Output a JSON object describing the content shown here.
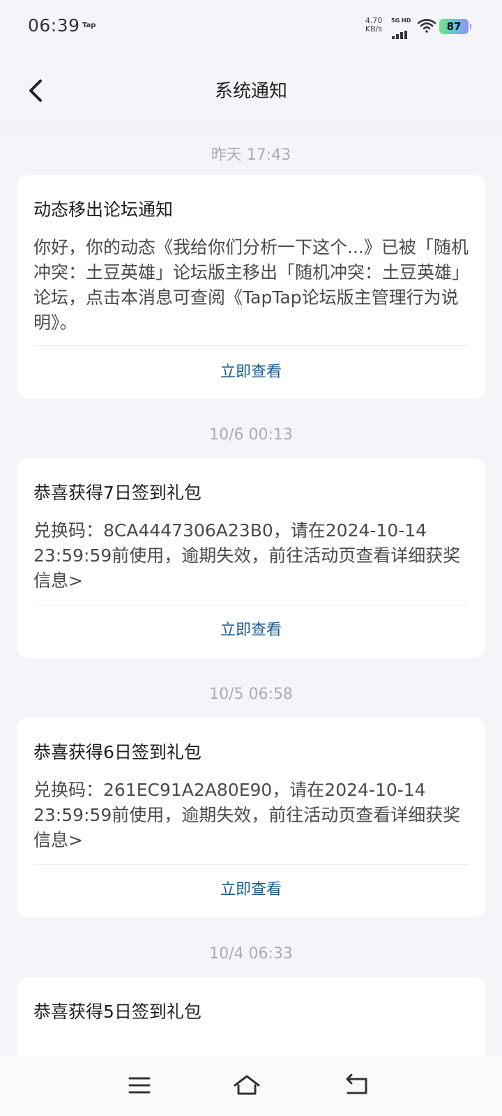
{
  "status_bar": {
    "time": "06:39",
    "app_mark": "Tap",
    "net_speed_value": "4.70",
    "net_speed_unit": "KB/s",
    "signal_label": "5G HD",
    "battery": "87",
    "icons": [
      "signal-icon",
      "wifi-icon",
      "battery-icon"
    ]
  },
  "header": {
    "title": "系统通知",
    "back_icon": "back-arrow-icon"
  },
  "messages": [
    {
      "time": "昨天  17:43",
      "title": "动态移出论坛通知",
      "body": "你好，你的动态《我给你们分析一下这个...》已被「随机冲突：土豆英雄」论坛版主移出「随机冲突：土豆英雄」论坛，点击本消息可查阅《TapTap论坛版主管理行为说明》。",
      "action": "立即查看"
    },
    {
      "time": "10/6  00:13",
      "title": "恭喜获得7日签到礼包",
      "body": "兑换码：8CA4447306A23B0，请在2024-10-14 23:59:59前使用，逾期失效，前往活动页查看详细获奖信息>",
      "action": "立即查看"
    },
    {
      "time": "10/5  06:58",
      "title": "恭喜获得6日签到礼包",
      "body": "兑换码：261EC91A2A80E90，请在2024-10-14 23:59:59前使用，逾期失效，前往活动页查看详细获奖信息>",
      "action": "立即查看"
    },
    {
      "time": "10/4  06:33",
      "title": "恭喜获得5日签到礼包"
    }
  ],
  "system_nav": {
    "icons": [
      "menu-icon",
      "home-icon",
      "back-icon"
    ]
  },
  "colors": {
    "background": "#f3f5f8",
    "card": "#ffffff",
    "link": "#1c5d8f",
    "timestamp": "#a9adb3"
  }
}
